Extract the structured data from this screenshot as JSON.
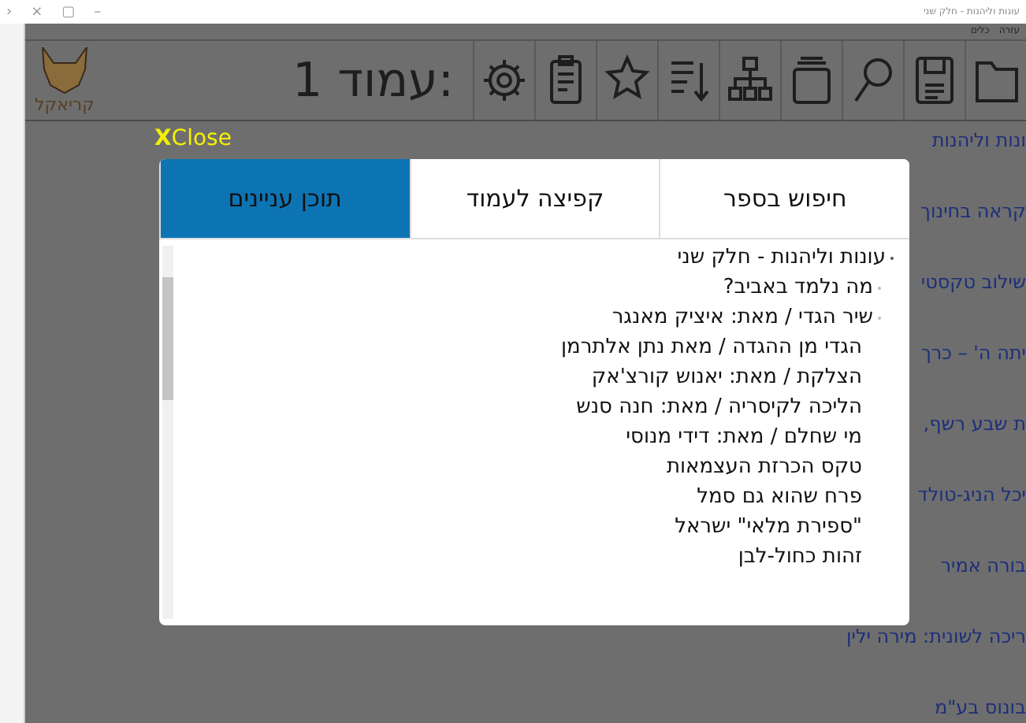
{
  "window": {
    "title": "עונות וליהנות - חלק שני",
    "controls": [
      "–",
      "▢",
      "×",
      "›"
    ]
  },
  "menu": [
    "עזרה",
    "כלים"
  ],
  "toolbar": {
    "logo_text": "קריאקל",
    "page_label": "עמוד 1:"
  },
  "background_list": [
    "ונות וליהנות",
    "קראה בחינוך",
    "שילוב טקסטי",
    "יתה ה' – כרך",
    "ת שבע רשף,",
    "יכל הניג-טולד",
    "בורה אמיר",
    "ריכה לשונית: מירה ילין",
    "בונוס בע\"מ"
  ],
  "dialog": {
    "close": {
      "mark": "X",
      "label": "Close"
    },
    "tabs": [
      {
        "label": "חיפוש בספר",
        "selected": false
      },
      {
        "label": "קפיצה לעמוד",
        "selected": false
      },
      {
        "label": "תוכן עניינים",
        "selected": true
      }
    ],
    "toc": [
      {
        "title": "עונות וליהנות -  חלק שני",
        "children": [
          {
            "title": "מה נלמד באביב?"
          },
          {
            "title": "שיר הגדי / מאת: איציק מאנגר",
            "children": [
              {
                "title": "הגדי מן ההגדה / מאת נתן אלתרמן"
              },
              {
                "title": "הצלקת / מאת: יאנוש  קורצ'אק"
              },
              {
                "title": "הליכה לקיסריה / מאת: חנה סנש"
              },
              {
                "title": "מי שחלם / מאת: דידי מנוסי"
              },
              {
                "title": "טקס הכרזת העצמאות"
              },
              {
                "title": "פרח שהוא גם סמל"
              },
              {
                "title": "\"ספירת מלאי\" ישראל"
              },
              {
                "title": "זהות כחול-לבן"
              }
            ]
          }
        ]
      }
    ]
  }
}
